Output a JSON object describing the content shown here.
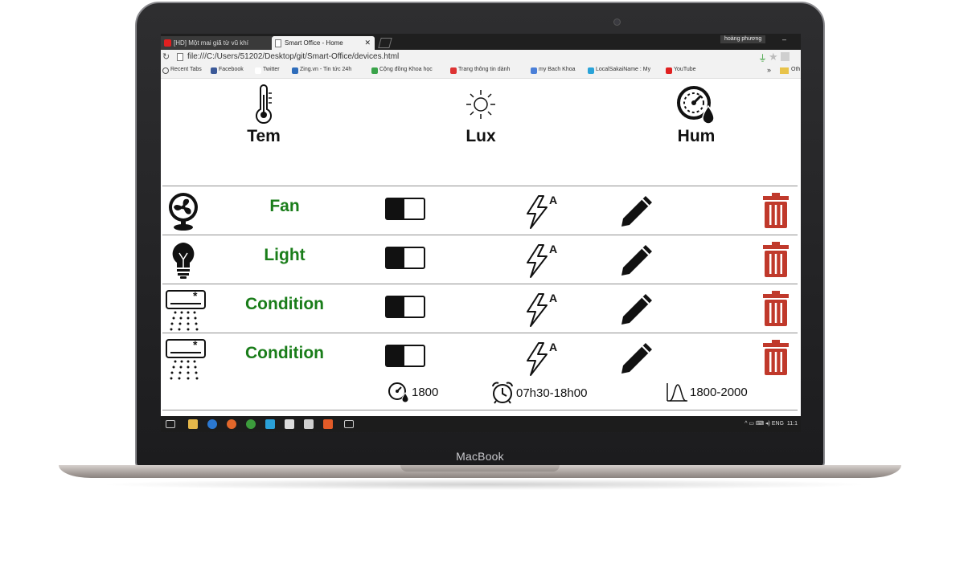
{
  "device_brand": "MacBook",
  "browser": {
    "tabs": [
      {
        "label": "[HD] Một mai giã từ vũ khí",
        "active": false
      },
      {
        "label": "Smart Office - Home",
        "active": true
      }
    ],
    "profile_name": "hoàng phương",
    "url": "file:///C:/Users/51202/Desktop/git/Smart-Office/devices.html",
    "bookmarks": [
      "Recent Tabs",
      "Facebook",
      "Twitter",
      "Zing.vn - Tin tức 24h",
      "Cộng đồng Khoa học",
      "Trang thông tin dành",
      "my Bach Khoa",
      "LocalSakaiName : My",
      "YouTube"
    ],
    "bookmarks_overflow": "»",
    "other_bookmarks": "Oth"
  },
  "sensors": [
    {
      "label": "Tem",
      "icon": "thermometer-icon"
    },
    {
      "label": "Lux",
      "icon": "sun-icon"
    },
    {
      "label": "Hum",
      "icon": "humidity-gauge-icon"
    }
  ],
  "devices": [
    {
      "name": "Fan",
      "icon": "fan-icon",
      "toggle_on": false
    },
    {
      "name": "Light",
      "icon": "lightbulb-icon",
      "toggle_on": false
    },
    {
      "name": "Condition",
      "icon": "air-conditioner-icon",
      "toggle_on": false
    },
    {
      "name": "Condition",
      "icon": "air-conditioner-icon",
      "toggle_on": false,
      "details": {
        "humidity": "1800",
        "schedule": "07h30-18h00",
        "range": "1800-2000"
      }
    }
  ],
  "taskbar": {
    "language": "ENG",
    "time": "11:1"
  },
  "colors": {
    "device_name": "#1a7d1a",
    "delete": "#c0392b",
    "toggle": "#111111"
  }
}
